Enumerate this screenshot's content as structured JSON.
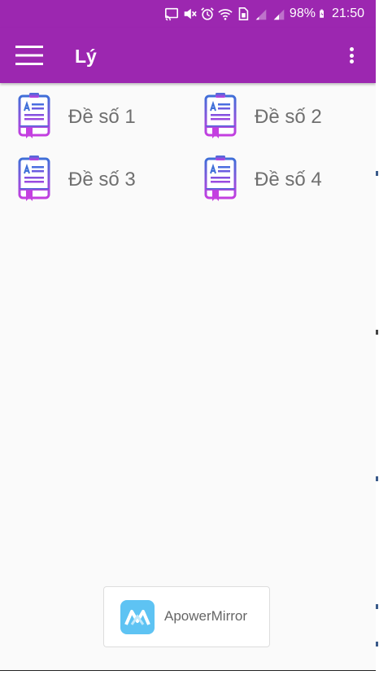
{
  "status_bar": {
    "battery": "98%",
    "time": "21:50"
  },
  "app_bar": {
    "title": "Lý"
  },
  "exams": [
    {
      "label": "Đề số 1"
    },
    {
      "label": "Đề số 2"
    },
    {
      "label": "Đề số 3"
    },
    {
      "label": "Đề số 4"
    }
  ],
  "watermark": {
    "text": "ApowerMirror"
  },
  "colors": {
    "primary": "#9c27b0",
    "icon_gradient_start": "#3f6fd8",
    "icon_gradient_end": "#c43fe0",
    "label_text": "#6f6f6f"
  },
  "icons": {
    "menu": "hamburger-icon",
    "overflow": "more-vertical-icon",
    "exam": "exam-document-icon"
  }
}
